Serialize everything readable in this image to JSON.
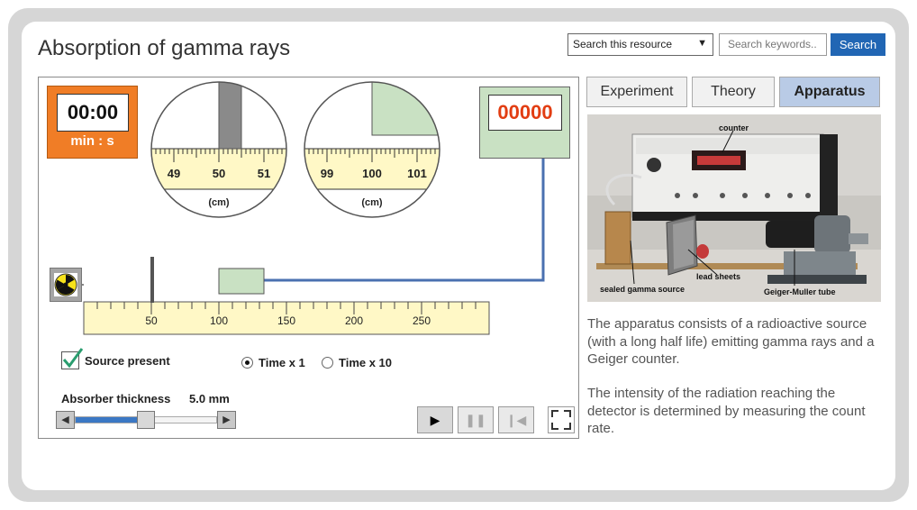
{
  "header": {
    "title": "Absorption of gamma rays",
    "search_scope": "Search this resource",
    "search_placeholder": "Search keywords..",
    "search_button": "Search"
  },
  "timer": {
    "value": "00:00",
    "units": "min : s"
  },
  "counter": {
    "value": "00000"
  },
  "magnifier_left": {
    "ticks": [
      "49",
      "50",
      "51"
    ],
    "unit": "(cm)"
  },
  "magnifier_right": {
    "ticks": [
      "99",
      "100",
      "101"
    ],
    "unit": "(cm)"
  },
  "ruler": {
    "ticks": [
      "50",
      "100",
      "150",
      "200",
      "250"
    ]
  },
  "controls": {
    "source_present": "Source present",
    "source_checked": true,
    "time_x1": "Time x 1",
    "time_x10": "Time x 10",
    "selected_time": "Time x 1",
    "absorber_label": "Absorber thickness",
    "absorber_value": "5.0 mm",
    "absorber_fraction": 0.5
  },
  "tabs": [
    {
      "label": "Experiment",
      "active": false
    },
    {
      "label": "Theory",
      "active": false
    },
    {
      "label": "Apparatus",
      "active": true
    }
  ],
  "photo_labels": {
    "counter": "counter",
    "lead_sheets": "lead sheets",
    "source": "sealed gamma source",
    "gm_tube": "Geiger-Muller tube"
  },
  "description": {
    "p1": "The apparatus consists of a radioactive source (with a long half life) emitting gamma rays and a Geiger counter.",
    "p2": "The intensity of the radiation reaching the detector is determined by measuring the count rate."
  },
  "colors": {
    "accent": "#2166b4",
    "timer_bg": "#f07d26",
    "counter_bg": "#c9e1c3",
    "counter_text": "#e23d12",
    "ruler_bg": "#fff8c6",
    "active_tab": "#b9cbe6",
    "check": "#2a9d6f"
  }
}
